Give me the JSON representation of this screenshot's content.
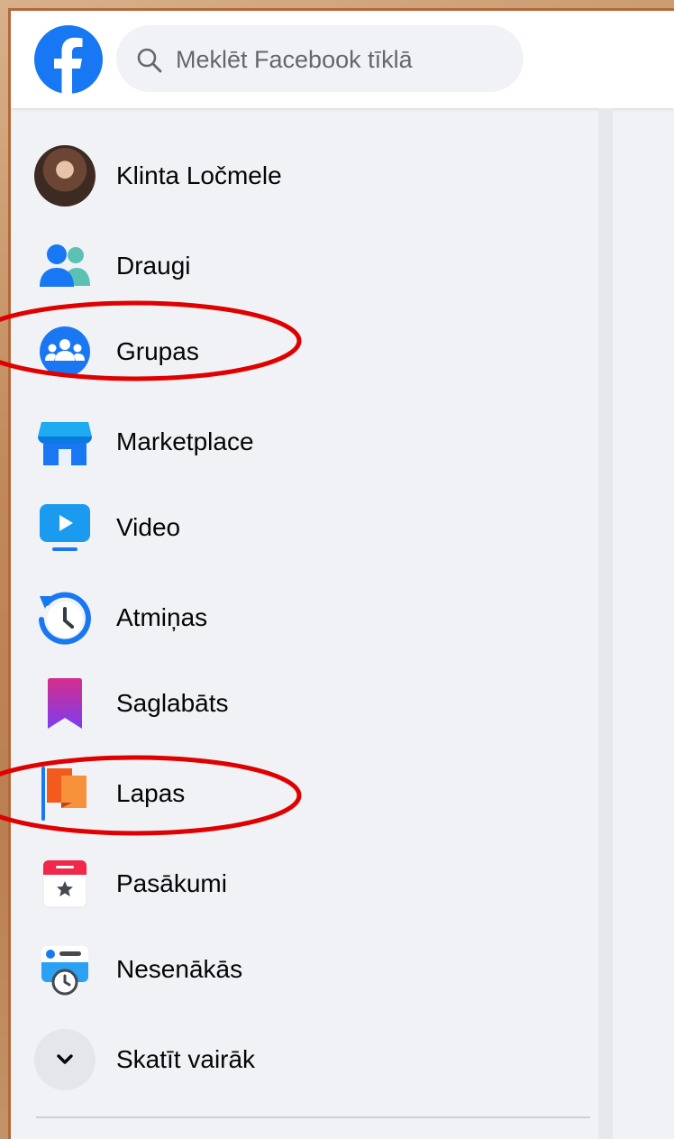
{
  "search": {
    "placeholder": "Meklēt Facebook tīklā"
  },
  "sidebar": {
    "items": [
      {
        "label": "Klinta Ločmele",
        "icon": "profile-avatar"
      },
      {
        "label": "Draugi",
        "icon": "friends-icon"
      },
      {
        "label": "Grupas",
        "icon": "groups-icon"
      },
      {
        "label": "Marketplace",
        "icon": "marketplace-icon"
      },
      {
        "label": "Video",
        "icon": "video-icon"
      },
      {
        "label": "Atmiņas",
        "icon": "memories-icon"
      },
      {
        "label": "Saglabāts",
        "icon": "saved-icon"
      },
      {
        "label": "Lapas",
        "icon": "pages-icon"
      },
      {
        "label": "Pasākumi",
        "icon": "events-icon"
      },
      {
        "label": "Nesenākās",
        "icon": "recent-icon"
      },
      {
        "label": "Skatīt vairāk",
        "icon": "chevron-down-icon"
      }
    ]
  },
  "annotations": {
    "highlight_color": "#e00000"
  },
  "colors": {
    "brand": "#1877f2",
    "sidebar_bg": "#f0f2f5"
  }
}
